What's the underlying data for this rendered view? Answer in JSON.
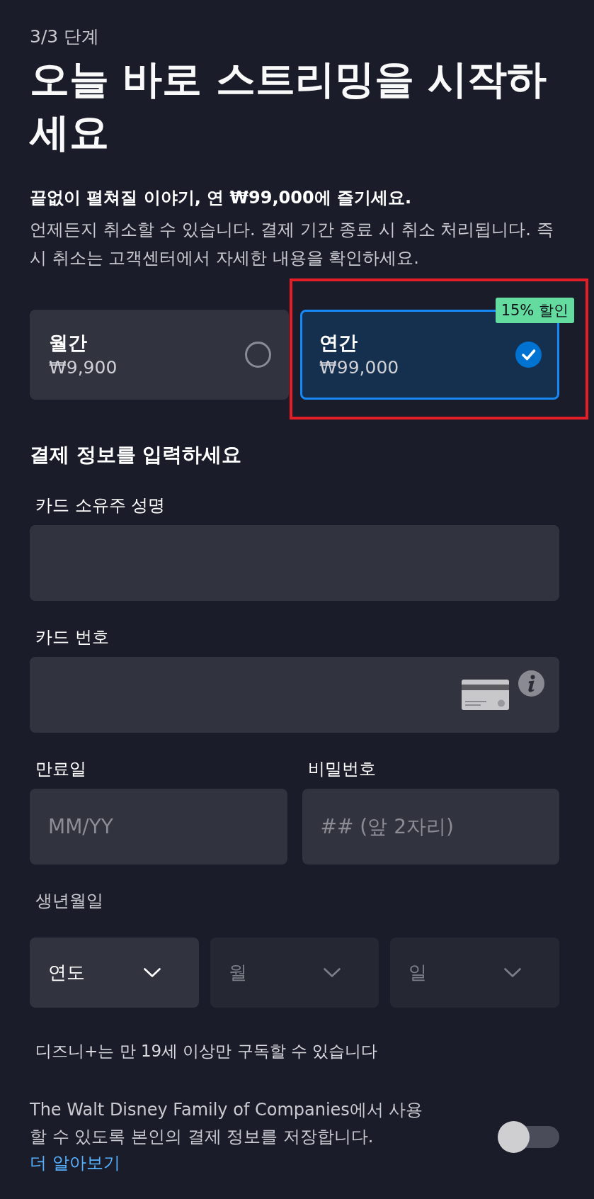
{
  "step": "3/3 단계",
  "title": "오늘 바로 스트리밍을 시작하세요",
  "tagline": "끝없이 펼쳐질 이야기, 연 ₩99,000에 즐기세요.",
  "description": "언제든지 취소할 수 있습니다. 결제 기간 종료 시 취소 처리됩니다. 즉시 취소는 고객센터에서 자세한 내용을 확인하세요.",
  "plans": [
    {
      "name": "월간",
      "price": "₩9,900",
      "selected": false,
      "highlighted": false
    },
    {
      "name": "연간",
      "price": "₩99,000",
      "selected": true,
      "highlighted": true,
      "badge": "15% 할인"
    }
  ],
  "payment": {
    "heading": "결제 정보를 입력하세요",
    "fields": [
      {
        "kind": "plain",
        "label": "카드 소유주 성명"
      },
      {
        "kind": "card_number",
        "label": "카드 번호"
      }
    ],
    "row_fields": [
      {
        "kind": "plain",
        "label": "만료일",
        "placeholder": "MM/YY"
      },
      {
        "kind": "plain",
        "label": "비밀번호",
        "placeholder": "## (앞 2자리)"
      }
    ]
  },
  "birth_date": {
    "label": "생년월일",
    "selects": [
      {
        "placeholder": "연도",
        "disabled": false
      },
      {
        "placeholder": "월",
        "disabled": true
      },
      {
        "placeholder": "일",
        "disabled": true
      }
    ]
  },
  "age_notice": "디즈니+는 만 19세 이상만 구독할 수 있습니다",
  "consent": {
    "text": "The Walt Disney Family of Companies에서 사용할 수 있도록 본인의 결제 정보를 저장합니다.",
    "link": "더 알아보기",
    "on": false
  }
}
